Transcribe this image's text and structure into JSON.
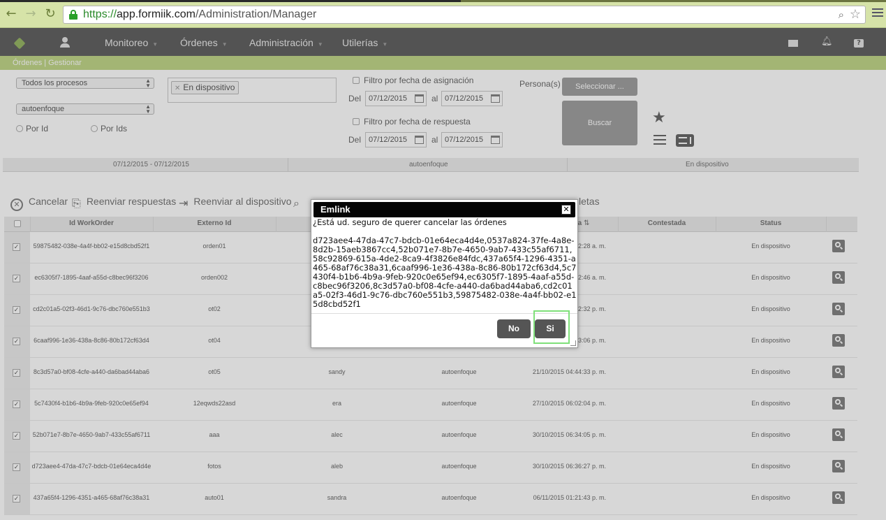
{
  "browser": {
    "url_protocol": "https://",
    "url_host": "app.formiik.com",
    "url_path": "/Administration/Manager"
  },
  "nav": {
    "items": [
      {
        "label": "Monitoreo"
      },
      {
        "label": "Órdenes"
      },
      {
        "label": "Administración"
      },
      {
        "label": "Utilerías"
      }
    ]
  },
  "breadcrumb": "Órdenes | Gestionar",
  "filters": {
    "process_select": "Todos los procesos",
    "focus_select": "autoenfoque",
    "tag": "En dispositivo",
    "radio_by_id": "Por Id",
    "radio_by_ids": "Por Ids",
    "assign_filter_label": "Filtro por fecha de asignación",
    "response_filter_label": "Filtro por fecha de respuesta",
    "del_label": "Del",
    "al_label": "al",
    "assign_from": "07/12/2015",
    "assign_to": "07/12/2015",
    "response_from": "07/12/2015",
    "response_to": "07/12/2015",
    "persons_label": "Persona(s)",
    "select_button": "Seleccionar ...",
    "search_button": "Buscar"
  },
  "summary": {
    "dates": "07/12/2015 - 07/12/2015",
    "process": "autoenfoque",
    "status": "En dispositivo"
  },
  "toolbar": {
    "cancel": "Cancelar",
    "resend_responses": "Reenviar respuestas",
    "resend_device": "Reenviar al dispositivo",
    "partial_label": "letas"
  },
  "table": {
    "headers": {
      "id": "Id WorkOrder",
      "external": "Externo Id",
      "date_partial": "a",
      "answered": "Contestada",
      "status": "Status"
    },
    "rows": [
      {
        "id": "59875482-038e-4a4f-bb02-e15d8cbd52f1",
        "ext": "orden01",
        "user": "",
        "process": "",
        "date": "2:28 a. m.",
        "status": "En dispositivo"
      },
      {
        "id": "ec6305f7-1895-4aaf-a55d-c8bec96f3206",
        "ext": "orden002",
        "user": "",
        "process": "",
        "date": "2:46 a. m.",
        "status": "En dispositivo"
      },
      {
        "id": "cd2c01a5-02f3-46d1-9c76-dbc760e551b3",
        "ext": "ot02",
        "user": "",
        "process": "",
        "date": "2:32 p. m.",
        "status": "En dispositivo"
      },
      {
        "id": "6caaf996-1e36-438a-8c86-80b172cf63d4",
        "ext": "ot04",
        "user": "",
        "process": "",
        "date": "3:06 p. m.",
        "status": "En dispositivo"
      },
      {
        "id": "8c3d57a0-bf08-4cfe-a440-da6bad44aba6",
        "ext": "ot05",
        "user": "sandy",
        "process": "autoenfoque",
        "date": "21/10/2015 04:44:33 p. m.",
        "status": "En dispositivo"
      },
      {
        "id": "5c7430f4-b1b6-4b9a-9feb-920c0e65ef94",
        "ext": "12eqwds22asd",
        "user": "era",
        "process": "autoenfoque",
        "date": "27/10/2015 06:02:04 p. m.",
        "status": "En dispositivo"
      },
      {
        "id": "52b071e7-8b7e-4650-9ab7-433c55af6711",
        "ext": "aaa",
        "user": "alec",
        "process": "autoenfoque",
        "date": "30/10/2015 06:34:05 p. m.",
        "status": "En dispositivo"
      },
      {
        "id": "d723aee4-47da-47c7-bdcb-01e64eca4d4e",
        "ext": "fotos",
        "user": "aleb",
        "process": "autoenfoque",
        "date": "30/10/2015 06:36:27 p. m.",
        "status": "En dispositivo"
      },
      {
        "id": "437a65f4-1296-4351-a465-68af76c38a31",
        "ext": "auto01",
        "user": "sandra",
        "process": "autoenfoque",
        "date": "06/11/2015 01:21:43 p. m.",
        "status": "En dispositivo"
      }
    ]
  },
  "dialog": {
    "title": "Emlink",
    "question": "¿Está ud. seguro de querer cancelar las órdenes",
    "ids": "d723aee4-47da-47c7-bdcb-01e64eca4d4e,0537a824-37fe-4a8e-8d2b-15aeb3867cc4,52b071e7-8b7e-4650-9ab7-433c55af6711,58c92869-615a-4de2-8ca9-4f3826e84fdc,437a65f4-1296-4351-a465-68af76c38a31,6caaf996-1e36-438a-8c86-80b172cf63d4,5c7430f4-b1b6-4b9a-9feb-920c0e65ef94,ec6305f7-1895-4aaf-a55d-c8bec96f3206,8c3d57a0-bf08-4cfe-a440-da6bad44aba6,cd2c01a5-02f3-46d1-9c76-dbc760e551b3,59875482-038e-4a4f-bb02-e15d8cbd52f1",
    "no_button": "No",
    "yes_button": "Si"
  }
}
